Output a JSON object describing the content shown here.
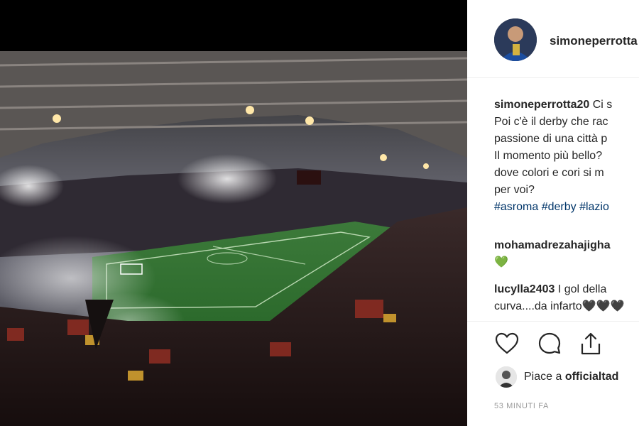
{
  "post": {
    "username": "simoneperrotta20",
    "header_username": "simoneperrotta",
    "caption_lines": [
      "Ci s",
      "Poi c'è il derby che rac",
      "passione di una città p",
      "Il momento più bello?",
      "dove colori e cori si m",
      "per voi?"
    ],
    "hashtags": "#asroma #derby #lazio"
  },
  "comments": [
    {
      "user": "mohamadrezahajigha",
      "text": "💚"
    },
    {
      "user": "lucylla2403",
      "text": "I gol della",
      "text2": "curva....da infarto🖤🖤🖤"
    }
  ],
  "actions": {
    "like_icon": "heart-icon",
    "comment_icon": "speech-bubble-icon",
    "share_icon": "share-icon"
  },
  "likes": {
    "prefix": "Piace a ",
    "user": "officialtad"
  },
  "timestamp": "53 MINUTI FA",
  "colors": {
    "text": "#262626",
    "hashtag": "#003569",
    "muted": "#999999",
    "divider": "#efefef",
    "heart_green": "#2fbf4a"
  }
}
